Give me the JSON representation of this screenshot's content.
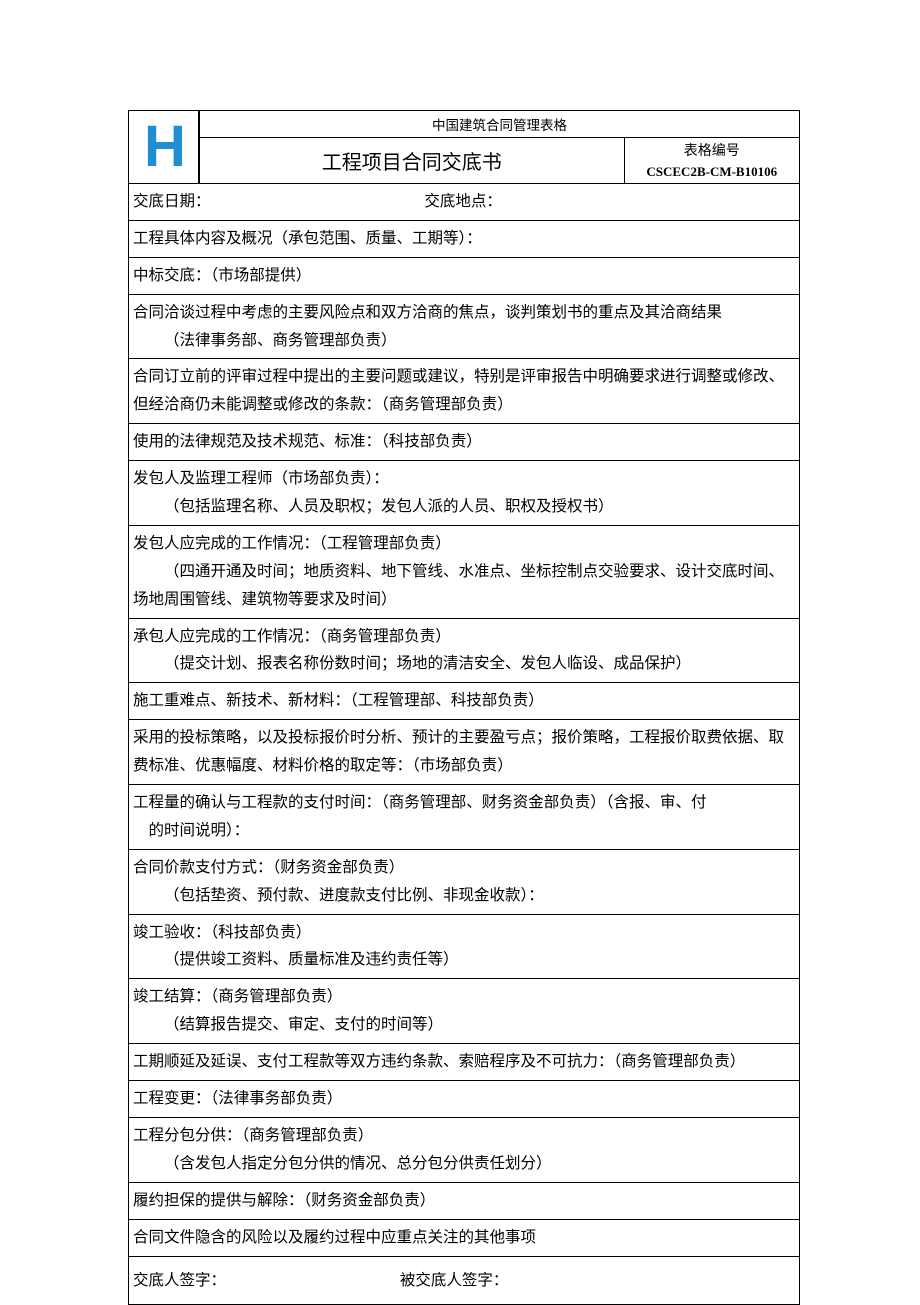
{
  "header": {
    "logo_text": "H",
    "org_title": "中国建筑合同管理表格",
    "doc_title": "工程项目合同交底书",
    "form_no_label": "表格编号",
    "form_no_value": "CSCEC2B-CM-B10106"
  },
  "fields": {
    "date_label": "交底日期：",
    "place_label": "交底地点："
  },
  "rows": {
    "r1": "工程具体内容及概况（承包范围、质量、工期等）：",
    "r2": "中标交底：（市场部提供）",
    "r3_a": "合同洽谈过程中考虑的主要风险点和双方洽商的焦点，谈判策划书的重点及其洽商结果",
    "r3_b": "（法律事务部、商务管理部负责）",
    "r4_a": "合同订立前的评审过程中提出的主要问题或建议，特别是评审报告中明确要求进行调整或修改、但经洽商仍未能调整或修改的条款：（商务管理部负责）",
    "r5": "使用的法律规范及技术规范、标准：（科技部负责）",
    "r6_a": "发包人及监理工程师（市场部负责）：",
    "r6_b": "（包括监理名称、人员及职权；发包人派的人员、职权及授权书）",
    "r7_a": "发包人应完成的工作情况：（工程管理部负责）",
    "r7_b": "（四通开通及时间；地质资料、地下管线、水准点、坐标控制点交验要求、设计交底时间、场地周围管线、建筑物等要求及时间）",
    "r8_a": "承包人应完成的工作情况：（商务管理部负责）",
    "r8_b": "（提交计划、报表名称份数时间；场地的清洁安全、发包人临设、成品保护）",
    "r9": "施工重难点、新技术、新材料：（工程管理部、科技部负责）",
    "r10": "采用的投标策略，以及投标报价时分析、预计的主要盈亏点；报价策略，工程报价取费依据、取费标准、优惠幅度、材料价格的取定等：（市场部负责）",
    "r11_a": "工程量的确认与工程款的支付时间：（商务管理部、财务资金部负责）（含报、审、付",
    "r11_b": "的时间说明）：",
    "r12_a": "合同价款支付方式：（财务资金部负责）",
    "r12_b": "（包括垫资、预付款、进度款支付比例、非现金收款）：",
    "r13_a": "竣工验收：（科技部负责）",
    "r13_b": "（提供竣工资料、质量标准及违约责任等）",
    "r14_a": "竣工结算：（商务管理部负责）",
    "r14_b": "（结算报告提交、审定、支付的时间等）",
    "r15": "工期顺延及延误、支付工程款等双方违约条款、索赔程序及不可抗力：（商务管理部负责）",
    "r16": "工程变更：（法律事务部负责）",
    "r17_a": "工程分包分供：（商务管理部负责）",
    "r17_b": "（含发包人指定分包分供的情况、总分包分供责任划分）",
    "r18": "履约担保的提供与解除：（财务资金部负责）",
    "r19": "合同文件隐含的风险以及履约过程中应重点关注的其他事项"
  },
  "sign": {
    "signer_label": "交底人签字：",
    "receiver_label": "被交底人签字："
  }
}
